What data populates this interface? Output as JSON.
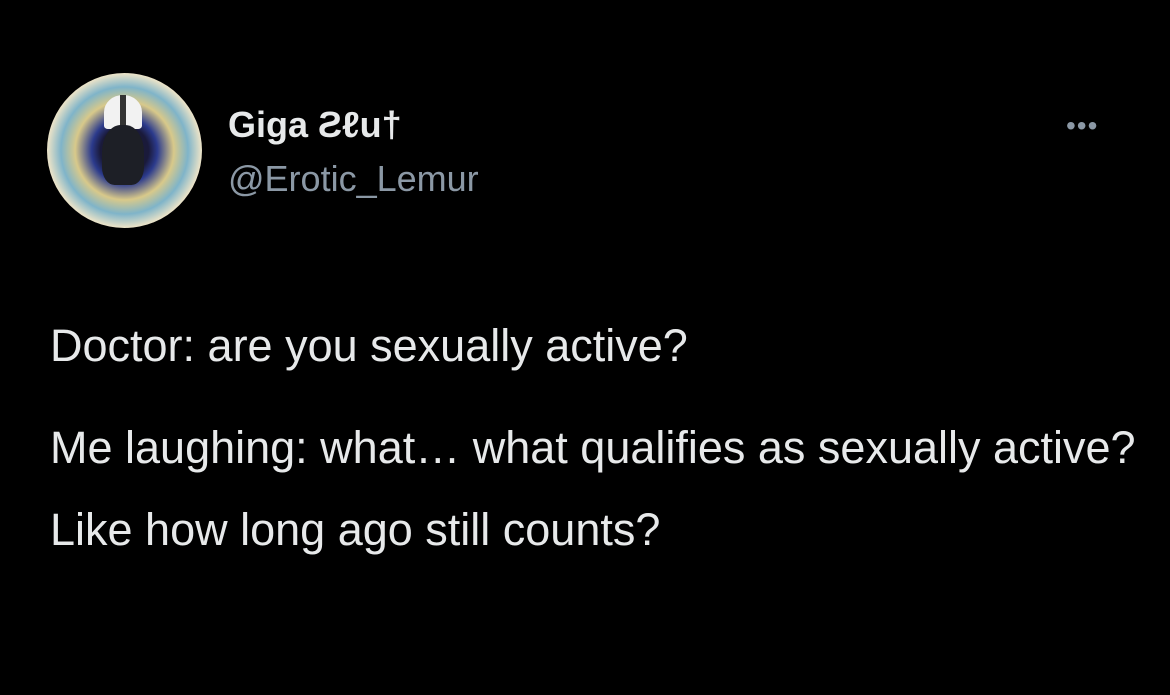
{
  "tweet": {
    "display_name": "Giga Ƨℓu†",
    "handle": "@Erotic_Lemur",
    "more_icon": "more-horizontal-icon",
    "paragraphs": [
      "Doctor: are you sexually active?",
      "Me laughing: what… what qualifies as sexually active? Like how long ago still counts?"
    ]
  }
}
